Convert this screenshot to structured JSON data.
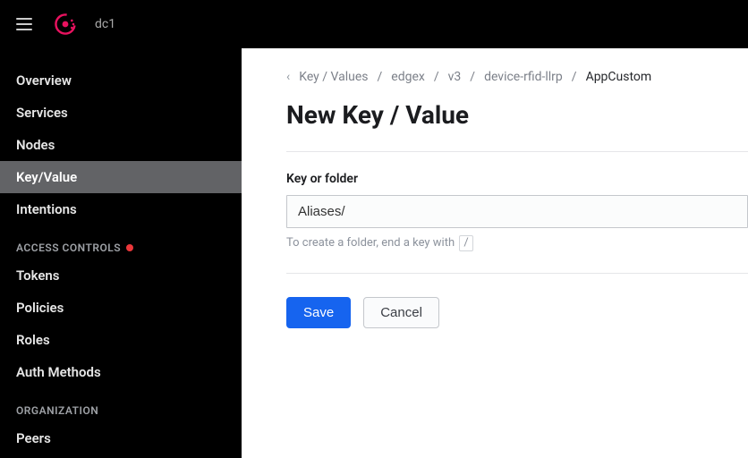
{
  "header": {
    "datacenter": "dc1"
  },
  "sidebar": {
    "items": [
      {
        "label": "Overview",
        "active": false
      },
      {
        "label": "Services",
        "active": false
      },
      {
        "label": "Nodes",
        "active": false
      },
      {
        "label": "Key/Value",
        "active": true
      },
      {
        "label": "Intentions",
        "active": false
      }
    ],
    "access_heading": "ACCESS CONTROLS",
    "access_items": [
      {
        "label": "Tokens"
      },
      {
        "label": "Policies"
      },
      {
        "label": "Roles"
      },
      {
        "label": "Auth Methods"
      }
    ],
    "org_heading": "ORGANIZATION",
    "org_items": [
      {
        "label": "Peers"
      }
    ]
  },
  "breadcrumb": {
    "sep": "/",
    "items": [
      {
        "label": "Key / Values",
        "current": false
      },
      {
        "label": "edgex",
        "current": false
      },
      {
        "label": "v3",
        "current": false
      },
      {
        "label": "device-rfid-llrp",
        "current": false
      },
      {
        "label": "AppCustom",
        "current": true
      }
    ]
  },
  "page": {
    "title": "New Key / Value",
    "field_label": "Key or folder",
    "key_value": "Aliases/",
    "hint_prefix": "To create a folder, end a key with",
    "hint_slash": "/",
    "save_label": "Save",
    "cancel_label": "Cancel"
  }
}
